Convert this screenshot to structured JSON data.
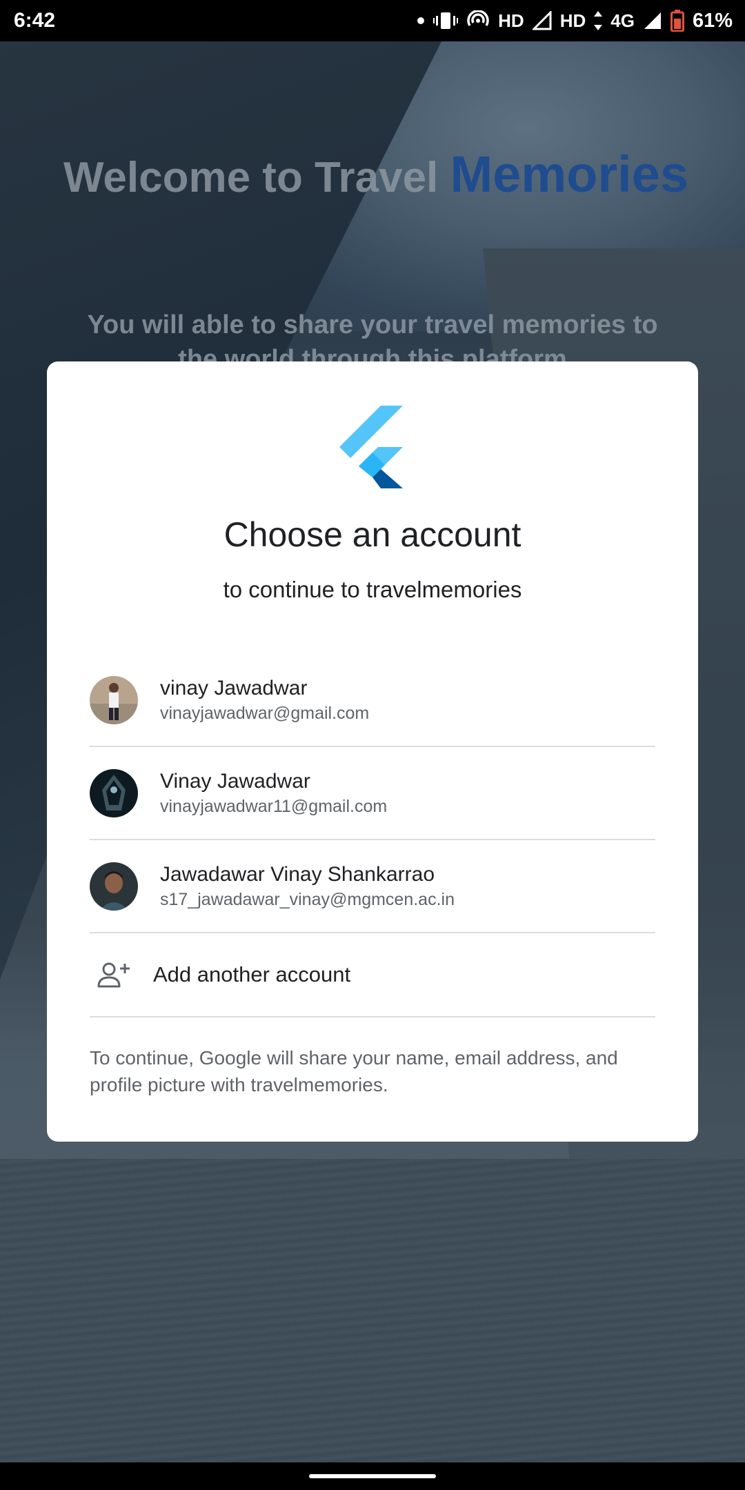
{
  "status_bar": {
    "time": "6:42",
    "network_labels": [
      "HD",
      "HD",
      "4G"
    ],
    "battery": "61%"
  },
  "background": {
    "title_part1": "Welcome to Travel ",
    "title_part2": "Memories",
    "subtitle_line1": "You will able to share your travel memories to",
    "subtitle_line2": "the world through this platform"
  },
  "dialog": {
    "logo_icon": "flutter-logo",
    "title": "Choose an account",
    "subtitle": "to continue to travelmemories",
    "accounts": [
      {
        "name": "vinay Jawadwar",
        "email": "vinayjawadwar@gmail.com",
        "avatar_color": "#b08a6a"
      },
      {
        "name": "Vinay Jawadwar",
        "email": "vinayjawadwar11@gmail.com",
        "avatar_color": "#0d1a22"
      },
      {
        "name": "Jawadawar Vinay Shankarrao",
        "email": "s17_jawadawar_vinay@mgmcen.ac.in",
        "avatar_color": "#2b3438"
      }
    ],
    "add_account_icon": "person-add-icon",
    "add_account_label": "Add another account",
    "disclaimer": "To continue, Google will share your name, email address, and profile picture with travelmemories."
  },
  "colors": {
    "accent": "#1f4c8f",
    "flutter_light": "#54c5f8",
    "flutter_dark": "#01579b"
  }
}
